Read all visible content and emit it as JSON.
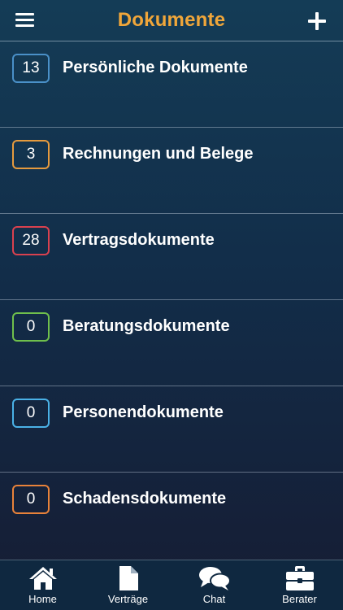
{
  "header": {
    "title": "Dokumente",
    "title_color": "#f0a63a",
    "menu_icon": "hamburger-menu-icon",
    "add_icon": "plus-icon"
  },
  "categories": [
    {
      "count": "13",
      "label": "Persönliche Dokumente",
      "color": "#4a90c8"
    },
    {
      "count": "3",
      "label": "Rechnungen und Belege",
      "color": "#e59a3e"
    },
    {
      "count": "28",
      "label": "Vertragsdokumente",
      "color": "#d9414f"
    },
    {
      "count": "0",
      "label": "Beratungsdokumente",
      "color": "#6fbf4c"
    },
    {
      "count": "0",
      "label": "Personendokumente",
      "color": "#4ab1e6"
    },
    {
      "count": "0",
      "label": "Schadensdokumente",
      "color": "#e8823a"
    }
  ],
  "tabbar": {
    "items": [
      {
        "label": "Home",
        "icon": "home-icon"
      },
      {
        "label": "Verträge",
        "icon": "document-icon"
      },
      {
        "label": "Chat",
        "icon": "chat-bubbles-icon"
      },
      {
        "label": "Berater",
        "icon": "briefcase-icon"
      }
    ]
  }
}
